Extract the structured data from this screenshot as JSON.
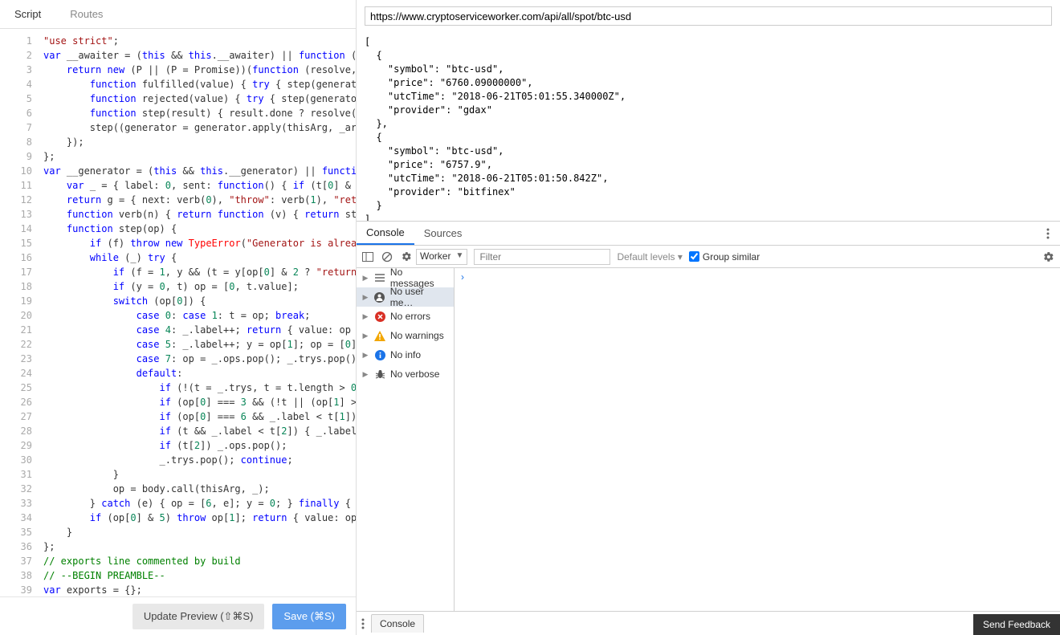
{
  "tabs": {
    "script": "Script",
    "routes": "Routes"
  },
  "url": "https://www.cryptoserviceworker.com/api/all/spot/btc-usd",
  "buttons": {
    "update": "Update Preview (⇧⌘S)",
    "save": "Save (⌘S)"
  },
  "code_lines": [
    {
      "n": 1,
      "html": "<span class='tok-str'>\"use strict\"</span>;"
    },
    {
      "n": 2,
      "html": "<span class='tok-kw'>var</span> __awaiter = (<span class='tok-kw'>this</span> && <span class='tok-kw'>this</span>.__awaiter) || <span class='tok-kw'>function</span> ("
    },
    {
      "n": 3,
      "html": "    <span class='tok-kw'>return</span> <span class='tok-kw'>new</span> (P || (P = Promise))(<span class='tok-kw'>function</span> (resolve,"
    },
    {
      "n": 4,
      "html": "        <span class='tok-kw'>function</span> fulfilled(value) { <span class='tok-kw'>try</span> { step(generat"
    },
    {
      "n": 5,
      "html": "        <span class='tok-kw'>function</span> rejected(value) { <span class='tok-kw'>try</span> { step(generato"
    },
    {
      "n": 6,
      "html": "        <span class='tok-kw'>function</span> step(result) { result.done ? resolve("
    },
    {
      "n": 7,
      "html": "        step((generator = generator.apply(thisArg, _ar"
    },
    {
      "n": 8,
      "html": "    });"
    },
    {
      "n": 9,
      "html": "};"
    },
    {
      "n": 10,
      "html": "<span class='tok-kw'>var</span> __generator = (<span class='tok-kw'>this</span> && <span class='tok-kw'>this</span>.__generator) || <span class='tok-kw'>functi</span>"
    },
    {
      "n": 11,
      "html": "    <span class='tok-kw'>var</span> _ = { label: <span class='tok-num'>0</span>, sent: <span class='tok-kw'>function</span>() { <span class='tok-kw'>if</span> (t[<span class='tok-num'>0</span>] &"
    },
    {
      "n": 12,
      "html": "    <span class='tok-kw'>return</span> g = { next: verb(<span class='tok-num'>0</span>), <span class='tok-str'>\"throw\"</span>: verb(<span class='tok-num'>1</span>), <span class='tok-str'>\"ret</span>"
    },
    {
      "n": 13,
      "html": "    <span class='tok-kw'>function</span> verb(n) { <span class='tok-kw'>return</span> <span class='tok-kw'>function</span> (v) { <span class='tok-kw'>return</span> st"
    },
    {
      "n": 14,
      "html": "    <span class='tok-kw'>function</span> step(op) {"
    },
    {
      "n": 15,
      "html": "        <span class='tok-kw'>if</span> (f) <span class='tok-kw'>throw</span> <span class='tok-kw'>new</span> <span class='tok-err'>TypeError</span>(<span class='tok-str'>\"Generator is alrea</span>"
    },
    {
      "n": 16,
      "html": "        <span class='tok-kw'>while</span> (_) <span class='tok-kw'>try</span> {"
    },
    {
      "n": 17,
      "html": "            <span class='tok-kw'>if</span> (f = <span class='tok-num'>1</span>, y && (t = y[op[<span class='tok-num'>0</span>] & <span class='tok-num'>2</span> ? <span class='tok-str'>\"return</span>"
    },
    {
      "n": 18,
      "html": "            <span class='tok-kw'>if</span> (y = <span class='tok-num'>0</span>, t) op = [<span class='tok-num'>0</span>, t.value];"
    },
    {
      "n": 19,
      "html": "            <span class='tok-kw'>switch</span> (op[<span class='tok-num'>0</span>]) {"
    },
    {
      "n": 20,
      "html": "                <span class='tok-kw'>case</span> <span class='tok-num'>0</span>: <span class='tok-kw'>case</span> <span class='tok-num'>1</span>: t = op; <span class='tok-kw'>break</span>;"
    },
    {
      "n": 21,
      "html": "                <span class='tok-kw'>case</span> <span class='tok-num'>4</span>: _.label++; <span class='tok-kw'>return</span> { value: op"
    },
    {
      "n": 22,
      "html": "                <span class='tok-kw'>case</span> <span class='tok-num'>5</span>: _.label++; y = op[<span class='tok-num'>1</span>]; op = [<span class='tok-num'>0</span>]"
    },
    {
      "n": 23,
      "html": "                <span class='tok-kw'>case</span> <span class='tok-num'>7</span>: op = _.ops.pop(); _.trys.pop()"
    },
    {
      "n": 24,
      "html": "                <span class='tok-kw'>default</span>:"
    },
    {
      "n": 25,
      "html": "                    <span class='tok-kw'>if</span> (!(t = _.trys, t = t.length > <span class='tok-num'>0</span>"
    },
    {
      "n": 26,
      "html": "                    <span class='tok-kw'>if</span> (op[<span class='tok-num'>0</span>] === <span class='tok-num'>3</span> && (!t || (op[<span class='tok-num'>1</span>] >"
    },
    {
      "n": 27,
      "html": "                    <span class='tok-kw'>if</span> (op[<span class='tok-num'>0</span>] === <span class='tok-num'>6</span> && _.label < t[<span class='tok-num'>1</span>])"
    },
    {
      "n": 28,
      "html": "                    <span class='tok-kw'>if</span> (t && _.label < t[<span class='tok-num'>2</span>]) { _.label"
    },
    {
      "n": 29,
      "html": "                    <span class='tok-kw'>if</span> (t[<span class='tok-num'>2</span>]) _.ops.pop();"
    },
    {
      "n": 30,
      "html": "                    _.trys.pop(); <span class='tok-kw'>continue</span>;"
    },
    {
      "n": 31,
      "html": "            }"
    },
    {
      "n": 32,
      "html": "            op = body.call(thisArg, _);"
    },
    {
      "n": 33,
      "html": "        } <span class='tok-kw'>catch</span> (e) { op = [<span class='tok-num'>6</span>, e]; y = <span class='tok-num'>0</span>; } <span class='tok-kw'>finally</span> {"
    },
    {
      "n": 34,
      "html": "        <span class='tok-kw'>if</span> (op[<span class='tok-num'>0</span>] & <span class='tok-num'>5</span>) <span class='tok-kw'>throw</span> op[<span class='tok-num'>1</span>]; <span class='tok-kw'>return</span> { value: op"
    },
    {
      "n": 35,
      "html": "    }"
    },
    {
      "n": 36,
      "html": "};"
    },
    {
      "n": 37,
      "html": "<span class='tok-com'>// exports line commented by build</span>"
    },
    {
      "n": 38,
      "html": "<span class='tok-com'>// --BEGIN PREAMBLE--</span>"
    },
    {
      "n": 39,
      "html": "<span class='tok-kw'>var</span> exports = {};"
    }
  ],
  "response_text": "[\n  {\n    \"symbol\": \"btc-usd\",\n    \"price\": \"6760.09000000\",\n    \"utcTime\": \"2018-06-21T05:01:55.340000Z\",\n    \"provider\": \"gdax\"\n  },\n  {\n    \"symbol\": \"btc-usd\",\n    \"price\": \"6757.9\",\n    \"utcTime\": \"2018-06-21T05:01:50.842Z\",\n    \"provider\": \"bitfinex\"\n  }\n]",
  "devtools": {
    "tabs": {
      "console": "Console",
      "sources": "Sources"
    },
    "context": "Worker",
    "filter_placeholder": "Filter",
    "levels": "Default levels ▾",
    "group": "Group similar",
    "sidebar": [
      {
        "label": "No messages",
        "icon": "list"
      },
      {
        "label": "No user me…",
        "icon": "user",
        "selected": true
      },
      {
        "label": "No errors",
        "icon": "error"
      },
      {
        "label": "No warnings",
        "icon": "warn"
      },
      {
        "label": "No info",
        "icon": "info"
      },
      {
        "label": "No verbose",
        "icon": "bug"
      }
    ],
    "main_arrow": "›",
    "drawer_tab": "Console"
  },
  "feedback": "Send Feedback"
}
